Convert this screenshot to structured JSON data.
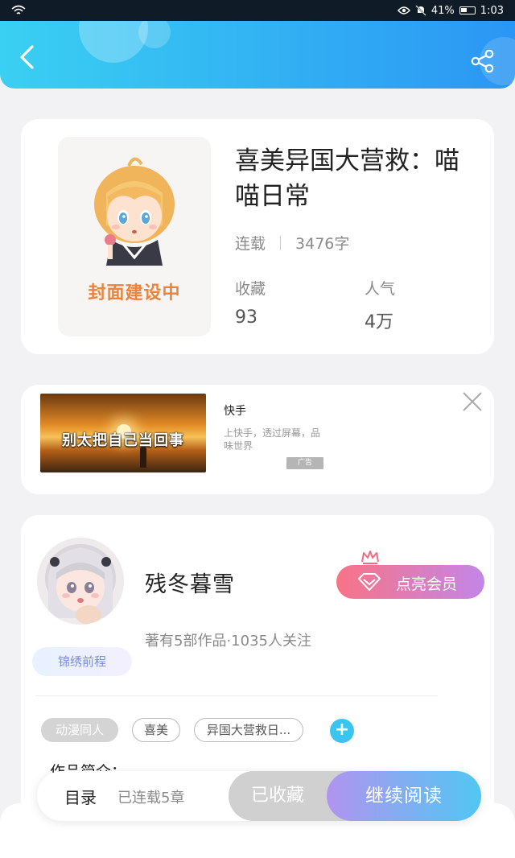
{
  "status_bar": {
    "battery_percent": "41%",
    "time": "1:03"
  },
  "header": {
    "back_icon": "chevron-left-icon",
    "share_icon": "share-icon"
  },
  "book": {
    "cover_text": "封面建设中",
    "title": "喜美异国大营救：喵喵日常",
    "status": "连载",
    "word_count": "3476字",
    "favorites_label": "收藏",
    "favorites_value": "93",
    "popularity_label": "人气",
    "popularity_value": "4万"
  },
  "ad": {
    "image_caption": "别太把自己当回事",
    "title": "快手",
    "description": "上快手，透过屏幕，品味世界",
    "badge": "广告"
  },
  "author": {
    "name": "残冬暮雪",
    "rank_badge": "锦绣前程",
    "stats": "著有5部作品·1035人关注",
    "vip_button": "点亮会员"
  },
  "tags": [
    "动漫同人",
    "喜美",
    "异国大营救日..."
  ],
  "intro_heading": "作品简介：",
  "bottom_bar": {
    "toc_label": "目录",
    "chapter_status": "已连载5章",
    "collected_button": "已收藏",
    "continue_button": "继续阅读"
  },
  "colors": {
    "header_gradient_start": "#3ad0f2",
    "header_gradient_end": "#2b96f4",
    "vip_gradient_start": "#f87386",
    "vip_gradient_end": "#c386e8",
    "continue_gradient_start": "#b194ef",
    "continue_gradient_end": "#51c7f3",
    "cover_text": "#e8843d"
  }
}
